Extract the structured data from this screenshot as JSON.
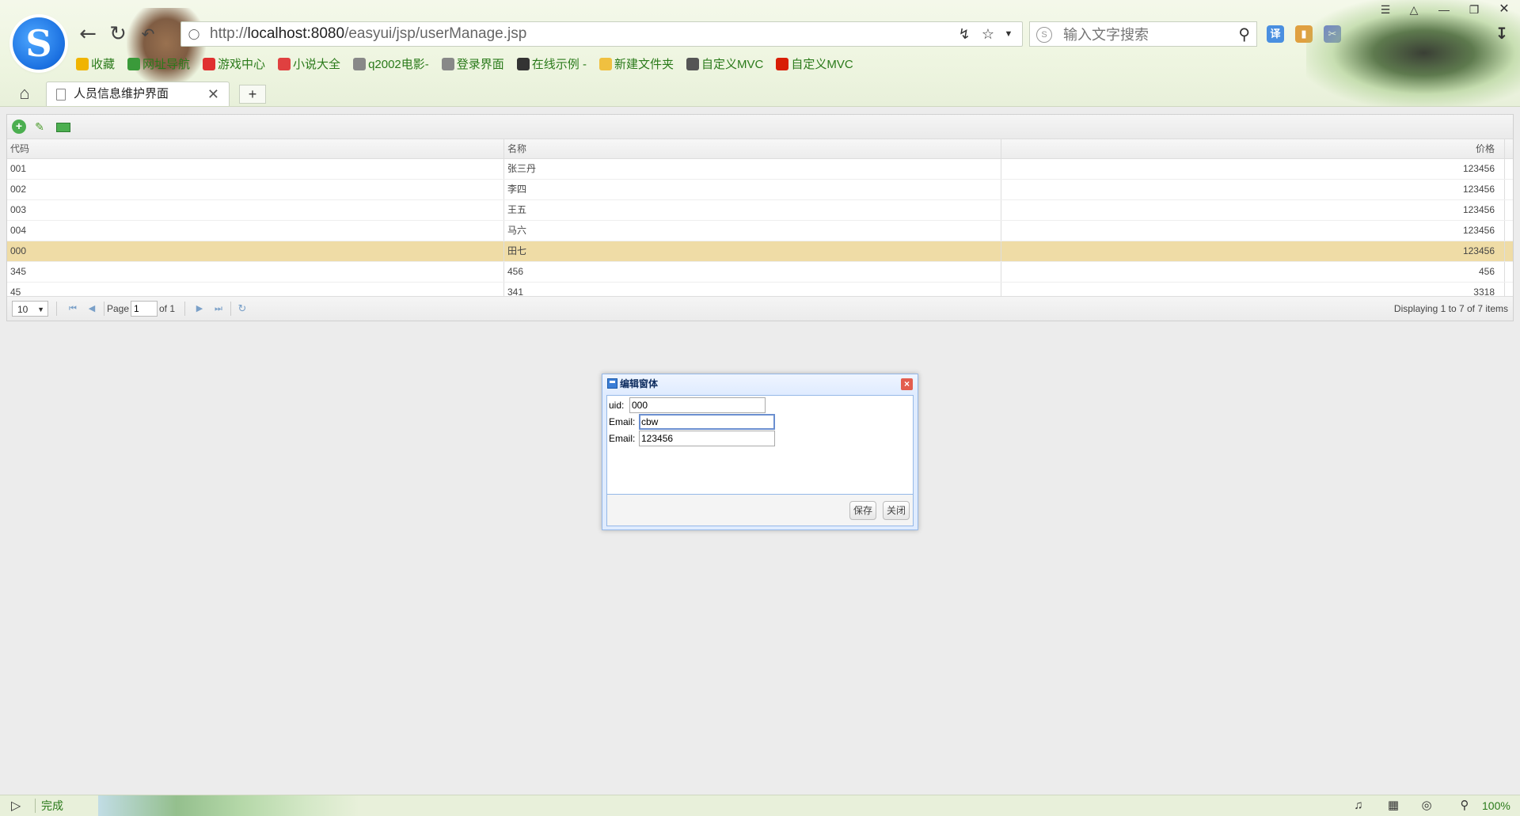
{
  "browser": {
    "url_prefix": "http://",
    "url_host": "localhost:8080",
    "url_path": "/easyui/jsp/userManage.jsp",
    "search_placeholder": "输入文字搜索",
    "bookmarks": [
      {
        "label": "收藏",
        "icon": "star-icon",
        "color": "#f0b400"
      },
      {
        "label": "网址导航",
        "icon": "globe-icon",
        "color": "#3a9a3a"
      },
      {
        "label": "游戏中心",
        "icon": "game-icon",
        "color": "#e03030"
      },
      {
        "label": "小说大全",
        "icon": "book-icon",
        "color": "#e04040"
      },
      {
        "label": "q2002电影-",
        "icon": "page-icon",
        "color": "#888888"
      },
      {
        "label": "登录界面",
        "icon": "page-icon",
        "color": "#888888"
      },
      {
        "label": "在线示例 -",
        "icon": "demo-icon",
        "color": "#333333"
      },
      {
        "label": "新建文件夹",
        "icon": "folder-icon",
        "color": "#f0c040"
      },
      {
        "label": "自定义MVC",
        "icon": "mvc-icon",
        "color": "#555555"
      },
      {
        "label": "自定义MVC",
        "icon": "csdn-icon",
        "color": "#d81e06"
      }
    ],
    "tab_title": "人员信息维护界面"
  },
  "grid": {
    "columns": [
      "代码",
      "名称",
      "价格"
    ],
    "rows": [
      {
        "code": "001",
        "name": "张三丹",
        "price": "123456"
      },
      {
        "code": "002",
        "name": "李四",
        "price": "123456"
      },
      {
        "code": "003",
        "name": "王五",
        "price": "123456"
      },
      {
        "code": "004",
        "name": "马六",
        "price": "123456"
      },
      {
        "code": "000",
        "name": "田七",
        "price": "123456"
      },
      {
        "code": "345",
        "name": "456",
        "price": "456"
      },
      {
        "code": "45",
        "name": "341",
        "price": "3318"
      }
    ],
    "selected_row": "000",
    "pager": {
      "page_size": "10",
      "page_label": "Page",
      "page_value": "1",
      "of_label": "of 1",
      "info": "Displaying 1 to 7 of 7 items"
    }
  },
  "dialog": {
    "title": "编辑窗体",
    "fields": [
      {
        "label": "uid:",
        "value": "000"
      },
      {
        "label": "Email:",
        "value": "cbw"
      },
      {
        "label": "Email:",
        "value": "123456"
      }
    ],
    "save_label": "保存",
    "close_label": "关闭"
  },
  "status": {
    "text": "完成",
    "zoom": "100%"
  },
  "colors": {
    "selected_row": "#efdca6",
    "dialog_border": "#95b8e7",
    "bookmark_text": "#2a7a1a"
  }
}
